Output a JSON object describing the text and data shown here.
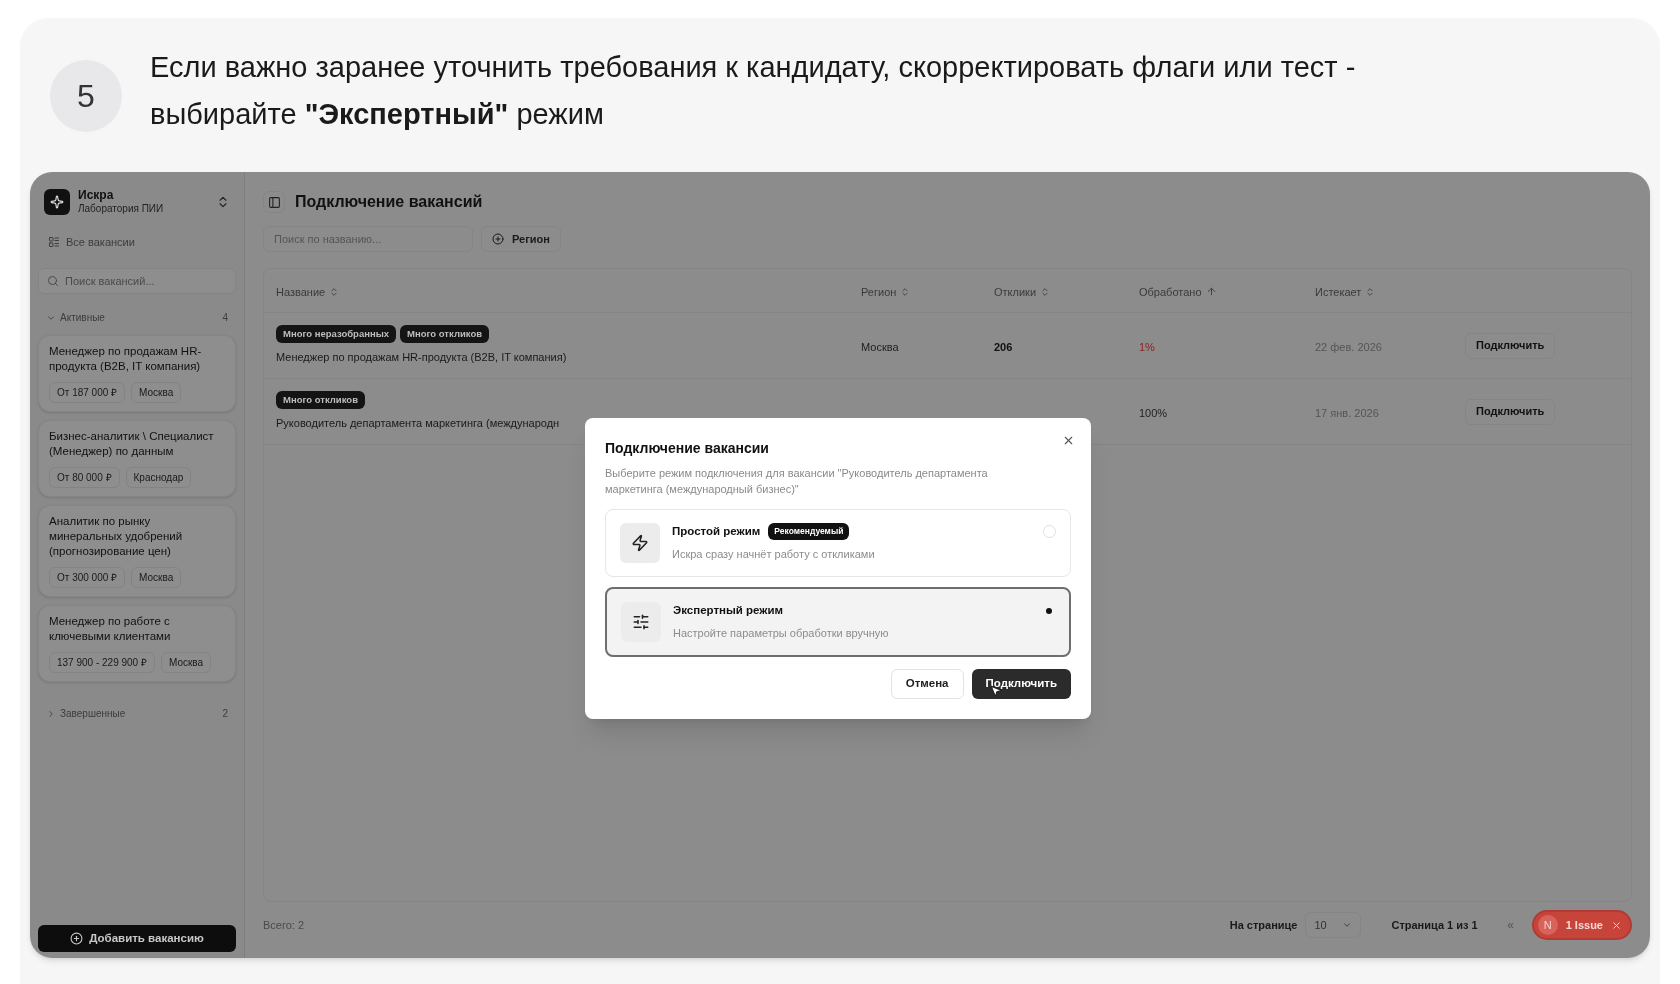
{
  "step": {
    "number": "5",
    "text": "Если важно заранее уточнить требования к кандидату, скорректировать флаги или тест - выбирайте **\"Экспертный\"** режим"
  },
  "sidebar": {
    "org_name": "Искра",
    "org_subtitle": "Лаборатория ПИИ",
    "all_link": "Все вакансии",
    "search_placeholder": "Поиск вакансий...",
    "groups": [
      {
        "label": "Активные",
        "count": "4",
        "expanded": true,
        "items": [
          {
            "title": "Менеджер по продажам HR-продукта (B2B, IT компания)",
            "salary": "От 187 000 ₽",
            "city": "Москва"
          },
          {
            "title": "Бизнес-аналитик \\ Специалист (Менеджер) по данным",
            "salary": "От 80 000 ₽",
            "city": "Краснодар"
          },
          {
            "title": "Аналитик по рынку минеральных удобрений (прогнозирование цен)",
            "salary": "От 300 000 ₽",
            "city": "Москва"
          },
          {
            "title": "Менеджер по работе с ключевыми клиентами",
            "salary": "137 900 - 229 900 ₽",
            "city": "Москва"
          }
        ]
      },
      {
        "label": "Завершенные",
        "count": "2",
        "expanded": false
      }
    ],
    "add_button": "Добавить вакансию"
  },
  "page": {
    "title": "Подключение вакансий",
    "search_placeholder": "Поиск по названию...",
    "filter_button": "Регион",
    "table": {
      "columns": [
        {
          "label": "Название",
          "sorted": false
        },
        {
          "label": "Регион",
          "sorted": false
        },
        {
          "label": "Отклики",
          "sorted": false
        },
        {
          "label": "Обработано",
          "sorted": true
        },
        {
          "label": "Истекает",
          "sorted": false
        }
      ],
      "rows": [
        {
          "tags": [
            "Много неразобранных",
            "Много откликов"
          ],
          "title": "Менеджер по продажам HR-продукта (B2B, IT компания)",
          "region": "Москва",
          "responses": "206",
          "processed": "1%",
          "alert": true,
          "expires": "22 фев. 2026",
          "action": "Подключить"
        },
        {
          "tags": [
            "Много откликов"
          ],
          "title": "Руководитель департамента маркетинга (международн",
          "processed": "100%",
          "alert": false,
          "expires": "17 янв. 2026",
          "action": "Подключить"
        }
      ]
    },
    "footer": {
      "total": "Всего: 2",
      "per_page_label": "На странице",
      "per_page": "10",
      "page_info": "Страница 1 из 1",
      "first_page": "«"
    }
  },
  "dialog": {
    "title": "Подключение вакансии",
    "description": "Выберите режим подключения для вакансии \"Руководитель департамента маркетинга (международный бизнес)\"",
    "options": [
      {
        "kind": "simple",
        "title": "Простой режим",
        "badge": "Рекомендуемый",
        "subtitle": "Искра сразу начнёт работу с откликами",
        "selected": false
      },
      {
        "kind": "expert",
        "title": "Экспертный режим",
        "subtitle": "Настройте параметры обработки вручную",
        "selected": true
      }
    ],
    "cancel": "Отмена",
    "confirm": "Подключить"
  },
  "dev_badge": {
    "letter": "N",
    "label": "1 Issue"
  }
}
